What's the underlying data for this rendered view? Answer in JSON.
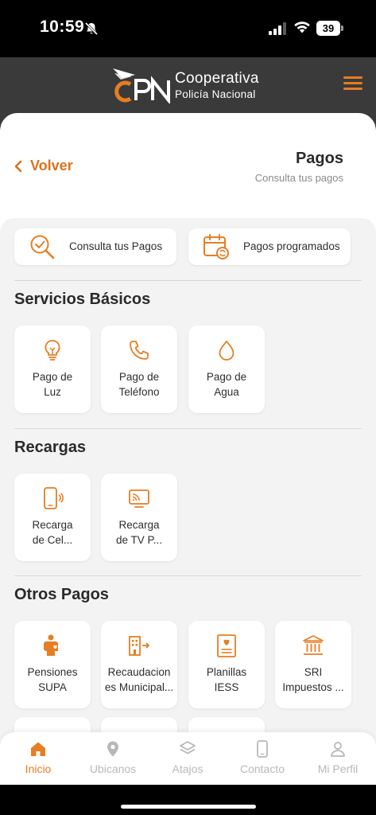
{
  "status_bar": {
    "time": "10:59",
    "battery": "39"
  },
  "brand": {
    "name_line1": "Cooperativa",
    "name_line2": "Policía Nacional",
    "accent": "#E67E22",
    "header_bg": "#3A3A3A"
  },
  "header": {
    "back_label": "Volver",
    "title": "Pagos",
    "subtitle": "Consulta tus pagos"
  },
  "quick_actions": [
    {
      "label": "Consulta tus Pagos",
      "icon": "search-check-icon"
    },
    {
      "label": "Pagos programados",
      "icon": "calendar-refresh-icon"
    }
  ],
  "sections": {
    "basic": {
      "title": "Servicios Básicos",
      "items": [
        {
          "line1": "Pago de",
          "line2": "Luz",
          "icon": "lightbulb-icon"
        },
        {
          "line1": "Pago de",
          "line2": "Teléfono",
          "icon": "phone-icon"
        },
        {
          "line1": "Pago de",
          "line2": "Agua",
          "icon": "water-drop-icon"
        }
      ]
    },
    "recharges": {
      "title": "Recargas",
      "items": [
        {
          "line1": "Recarga",
          "line2": "de Cel...",
          "icon": "mobile-phone-icon"
        },
        {
          "line1": "Recarga",
          "line2": "de TV P...",
          "icon": "tv-cast-icon"
        }
      ]
    },
    "others": {
      "title": "Otros Pagos",
      "items": [
        {
          "line1": "Pensiones",
          "line2": "SUPA",
          "icon": "child-support-icon"
        },
        {
          "line1": "Recaudacion",
          "line2": "es Municipal...",
          "icon": "building-arrow-icon"
        },
        {
          "line1": "Planillas",
          "line2": "IESS",
          "icon": "document-heart-icon"
        },
        {
          "line1": "SRI",
          "line2": "Impuestos ...",
          "icon": "bank-icon"
        }
      ]
    }
  },
  "bottom_nav": [
    {
      "label": "Inicio",
      "icon": "home-icon",
      "active": true
    },
    {
      "label": "Ubicanos",
      "icon": "location-pin-icon",
      "active": false
    },
    {
      "label": "Atajos",
      "icon": "layers-icon",
      "active": false
    },
    {
      "label": "Contacto",
      "icon": "smartphone-icon",
      "active": false
    },
    {
      "label": "Mi Perfil",
      "icon": "user-icon",
      "active": false
    }
  ]
}
